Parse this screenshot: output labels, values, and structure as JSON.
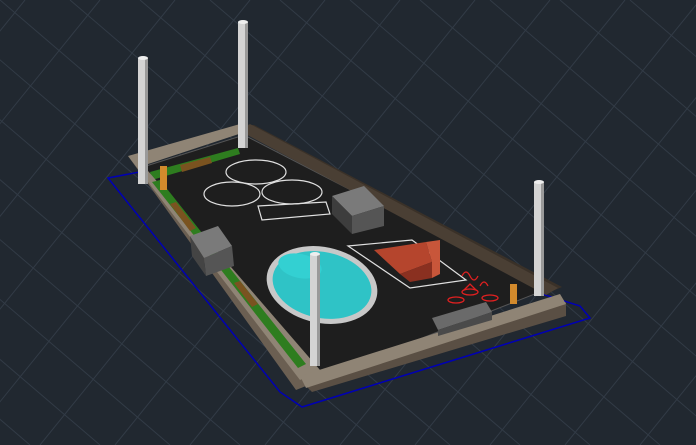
{
  "viewport": {
    "name": "autocad-3d-model-viewport",
    "background": "#212830",
    "grid_color": "#323b46"
  },
  "model": {
    "description_icons": [
      "pillar-icon",
      "pool-icon",
      "ramp-icon",
      "box-icon"
    ],
    "colors": {
      "wall_top": "#8f8475",
      "wall_side": "#6b5f52",
      "wall_dark": "#3a3128",
      "floor": "#1e1e1e",
      "floor_edge": "#0000b4",
      "pillar": "#d4d4d4",
      "pool_water": "#2fc3c6",
      "pool_rim": "#c8c8c8",
      "ramp": "#b5452d",
      "box": "#6a6a6a",
      "hedge_green": "#2e7d1f",
      "hedge_brown": "#7a5320",
      "post_orange": "#d28a2c",
      "outline_white": "#e0e0e0",
      "red_marks": "#e02020"
    }
  }
}
